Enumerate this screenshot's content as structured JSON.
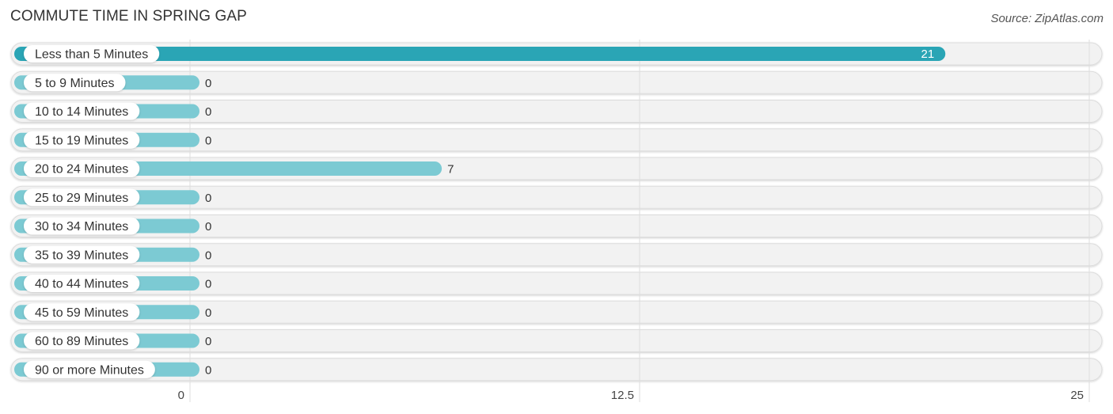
{
  "header": {
    "title": "COMMUTE TIME IN SPRING GAP",
    "source": "Source: ZipAtlas.com"
  },
  "colors": {
    "bar_highlight": "#2aa5b5",
    "bar_normal": "#7ccad3",
    "track": "#f2f2f2",
    "grid": "#dddddd"
  },
  "chart_data": {
    "type": "bar",
    "orientation": "horizontal",
    "title": "COMMUTE TIME IN SPRING GAP",
    "xlabel": "",
    "ylabel": "",
    "xlim": [
      0,
      25
    ],
    "x_ticks": [
      "0",
      "12.5",
      "25"
    ],
    "x_tick_values": [
      0,
      12.5,
      25
    ],
    "grid": true,
    "categories": [
      "Less than 5 Minutes",
      "5 to 9 Minutes",
      "10 to 14 Minutes",
      "15 to 19 Minutes",
      "20 to 24 Minutes",
      "25 to 29 Minutes",
      "30 to 34 Minutes",
      "35 to 39 Minutes",
      "40 to 44 Minutes",
      "45 to 59 Minutes",
      "60 to 89 Minutes",
      "90 or more Minutes"
    ],
    "values": [
      21,
      0,
      0,
      0,
      7,
      0,
      0,
      0,
      0,
      0,
      0,
      0
    ],
    "value_labels": [
      "21",
      "0",
      "0",
      "0",
      "7",
      "0",
      "0",
      "0",
      "0",
      "0",
      "0",
      "0"
    ]
  }
}
